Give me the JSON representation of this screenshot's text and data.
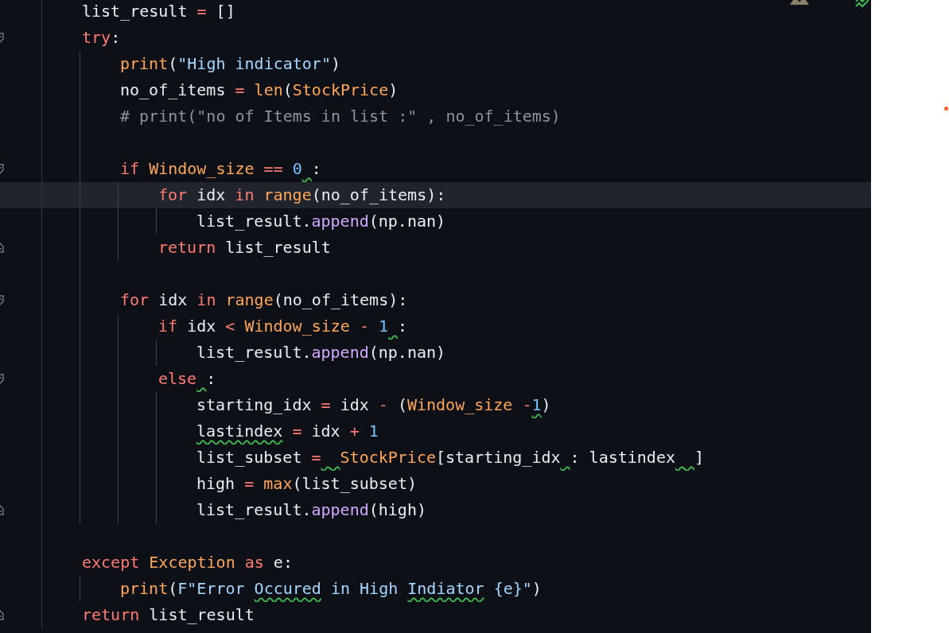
{
  "lines": [
    {
      "kind": "plain",
      "current": false,
      "tokens": [
        {
          "kind": "plain",
          "text": "list_result "
        },
        {
          "kind": "op",
          "text": "= "
        },
        {
          "kind": "plain",
          "text": "[]"
        }
      ]
    },
    {
      "kind": "fold_start",
      "current": false,
      "tokens": [
        {
          "kind": "kw",
          "text": "try"
        },
        {
          "kind": "plain",
          "text": ":"
        }
      ],
      "children": [
        {
          "kind": "plain",
          "current": false,
          "tokens": [
            {
              "kind": "fn",
              "text": "print"
            },
            {
              "kind": "plain",
              "text": "("
            },
            {
              "kind": "str",
              "text": "\"High indicator\""
            },
            {
              "kind": "plain",
              "text": ")"
            }
          ]
        },
        {
          "kind": "plain",
          "current": false,
          "tokens": [
            {
              "kind": "plain",
              "text": "no_of_items "
            },
            {
              "kind": "op",
              "text": "= "
            },
            {
              "kind": "fn",
              "text": "len"
            },
            {
              "kind": "plain",
              "text": "("
            },
            {
              "kind": "fn",
              "text": "StockPrice"
            },
            {
              "kind": "plain",
              "text": ")"
            }
          ]
        },
        {
          "kind": "plain",
          "current": false,
          "tokens": [
            {
              "kind": "comment",
              "text": "# print(\"no of Items in list :\" , no_of_items)"
            }
          ]
        },
        {
          "kind": "blank",
          "current": false
        },
        {
          "kind": "fold_start",
          "current": false,
          "tokens": [
            {
              "kind": "kw",
              "text": "if "
            },
            {
              "kind": "fn",
              "text": "Window_size"
            },
            {
              "kind": "op",
              "text": " == "
            },
            {
              "kind": "num",
              "text": "0"
            },
            {
              "kind": "gap"
            },
            {
              "kind": "plain",
              "text": ":"
            }
          ],
          "children": [
            {
              "kind": "plain",
              "current": true,
              "tokens": [
                {
                  "kind": "kw",
                  "text": "for "
                },
                {
                  "kind": "plain",
                  "text": "idx "
                },
                {
                  "kind": "kw",
                  "text": "in "
                },
                {
                  "kind": "fn",
                  "text": "range"
                },
                {
                  "kind": "plain",
                  "text": "(no_of_items):"
                }
              ],
              "children": [
                {
                  "kind": "plain",
                  "current": false,
                  "tokens": [
                    {
                      "kind": "plain",
                      "text": "list_result."
                    },
                    {
                      "kind": "method",
                      "text": "append"
                    },
                    {
                      "kind": "plain",
                      "text": "(np.nan)"
                    }
                  ]
                }
              ]
            },
            {
              "kind": "fold_end",
              "current": false,
              "tokens": [
                {
                  "kind": "kw",
                  "text": "return "
                },
                {
                  "kind": "plain",
                  "text": "list_result"
                }
              ]
            }
          ]
        },
        {
          "kind": "blank",
          "current": false
        },
        {
          "kind": "fold_start",
          "current": false,
          "tokens": [
            {
              "kind": "kw",
              "text": "for "
            },
            {
              "kind": "plain",
              "text": "idx "
            },
            {
              "kind": "kw",
              "text": "in "
            },
            {
              "kind": "fn",
              "text": "range"
            },
            {
              "kind": "plain",
              "text": "(no_of_items):"
            }
          ],
          "children": [
            {
              "kind": "plain",
              "current": false,
              "tokens": [
                {
                  "kind": "kw",
                  "text": "if "
                },
                {
                  "kind": "plain",
                  "text": "idx "
                },
                {
                  "kind": "op",
                  "text": "< "
                },
                {
                  "kind": "fn",
                  "text": "Window_size"
                },
                {
                  "kind": "op",
                  "text": " - "
                },
                {
                  "kind": "num",
                  "text": "1"
                },
                {
                  "kind": "gap"
                },
                {
                  "kind": "plain",
                  "text": ":"
                }
              ],
              "children": [
                {
                  "kind": "plain",
                  "current": false,
                  "tokens": [
                    {
                      "kind": "plain",
                      "text": "list_result."
                    },
                    {
                      "kind": "method",
                      "text": "append"
                    },
                    {
                      "kind": "plain",
                      "text": "(np.nan)"
                    }
                  ]
                }
              ]
            },
            {
              "kind": "fold_start",
              "current": false,
              "tokens": [
                {
                  "kind": "kw",
                  "text": "else"
                },
                {
                  "kind": "gap"
                },
                {
                  "kind": "plain",
                  "text": ":"
                }
              ],
              "children": [
                {
                  "kind": "plain",
                  "current": false,
                  "tokens": [
                    {
                      "kind": "plain",
                      "text": "starting_idx "
                    },
                    {
                      "kind": "op",
                      "text": "= "
                    },
                    {
                      "kind": "plain",
                      "text": "idx "
                    },
                    {
                      "kind": "op",
                      "text": "- "
                    },
                    {
                      "kind": "plain",
                      "text": "("
                    },
                    {
                      "kind": "fn",
                      "text": "Window_size"
                    },
                    {
                      "kind": "op",
                      "text": " -"
                    },
                    {
                      "kind": "wavynum",
                      "text": "1"
                    },
                    {
                      "kind": "plain",
                      "text": ")"
                    }
                  ]
                },
                {
                  "kind": "plain",
                  "current": false,
                  "tokens": [
                    {
                      "kind": "wavy",
                      "text": "lastindex"
                    },
                    {
                      "kind": "op",
                      "text": " = "
                    },
                    {
                      "kind": "plain",
                      "text": "idx "
                    },
                    {
                      "kind": "op",
                      "text": "+ "
                    },
                    {
                      "kind": "num",
                      "text": "1"
                    }
                  ]
                },
                {
                  "kind": "plain",
                  "current": false,
                  "tokens": [
                    {
                      "kind": "plain",
                      "text": "list_subset "
                    },
                    {
                      "kind": "op",
                      "text": "="
                    },
                    {
                      "kind": "gap"
                    },
                    {
                      "kind": "gap"
                    },
                    {
                      "kind": "fn",
                      "text": "StockPrice"
                    },
                    {
                      "kind": "plain",
                      "text": "[starting_idx"
                    },
                    {
                      "kind": "gap"
                    },
                    {
                      "kind": "plain",
                      "text": ": lastindex"
                    },
                    {
                      "kind": "gap"
                    },
                    {
                      "kind": "gap"
                    },
                    {
                      "kind": "plain",
                      "text": "]"
                    }
                  ]
                },
                {
                  "kind": "plain",
                  "current": false,
                  "tokens": [
                    {
                      "kind": "plain",
                      "text": "high "
                    },
                    {
                      "kind": "op",
                      "text": "= "
                    },
                    {
                      "kind": "fn",
                      "text": "max"
                    },
                    {
                      "kind": "plain",
                      "text": "(list_subset)"
                    }
                  ]
                },
                {
                  "kind": "fold_end",
                  "current": false,
                  "tokens": [
                    {
                      "kind": "plain",
                      "text": "list_result."
                    },
                    {
                      "kind": "method",
                      "text": "append"
                    },
                    {
                      "kind": "plain",
                      "text": "(high)"
                    }
                  ]
                }
              ]
            }
          ]
        }
      ]
    },
    {
      "kind": "blank",
      "current": false
    },
    {
      "kind": "plain",
      "current": false,
      "tokens": [
        {
          "kind": "kw",
          "text": "except "
        },
        {
          "kind": "fn",
          "text": "Exception "
        },
        {
          "kind": "kw",
          "text": "as "
        },
        {
          "kind": "plain",
          "text": "e:"
        }
      ],
      "children": [
        {
          "kind": "plain",
          "current": false,
          "tokens": [
            {
              "kind": "fn",
              "text": "print"
            },
            {
              "kind": "plain",
              "text": "("
            },
            {
              "kind": "str",
              "text": "F\"Error "
            },
            {
              "kind": "wavystr",
              "text": "Occured"
            },
            {
              "kind": "str",
              "text": " in High "
            },
            {
              "kind": "wavystr",
              "text": "Indiator"
            },
            {
              "kind": "str",
              "text": " {e}\""
            },
            {
              "kind": "plain",
              "text": ")"
            }
          ]
        }
      ]
    },
    {
      "kind": "fold_end",
      "current": false,
      "tokens": [
        {
          "kind": "kw",
          "text": "return "
        },
        {
          "kind": "plain",
          "text": "list_result"
        }
      ]
    }
  ]
}
